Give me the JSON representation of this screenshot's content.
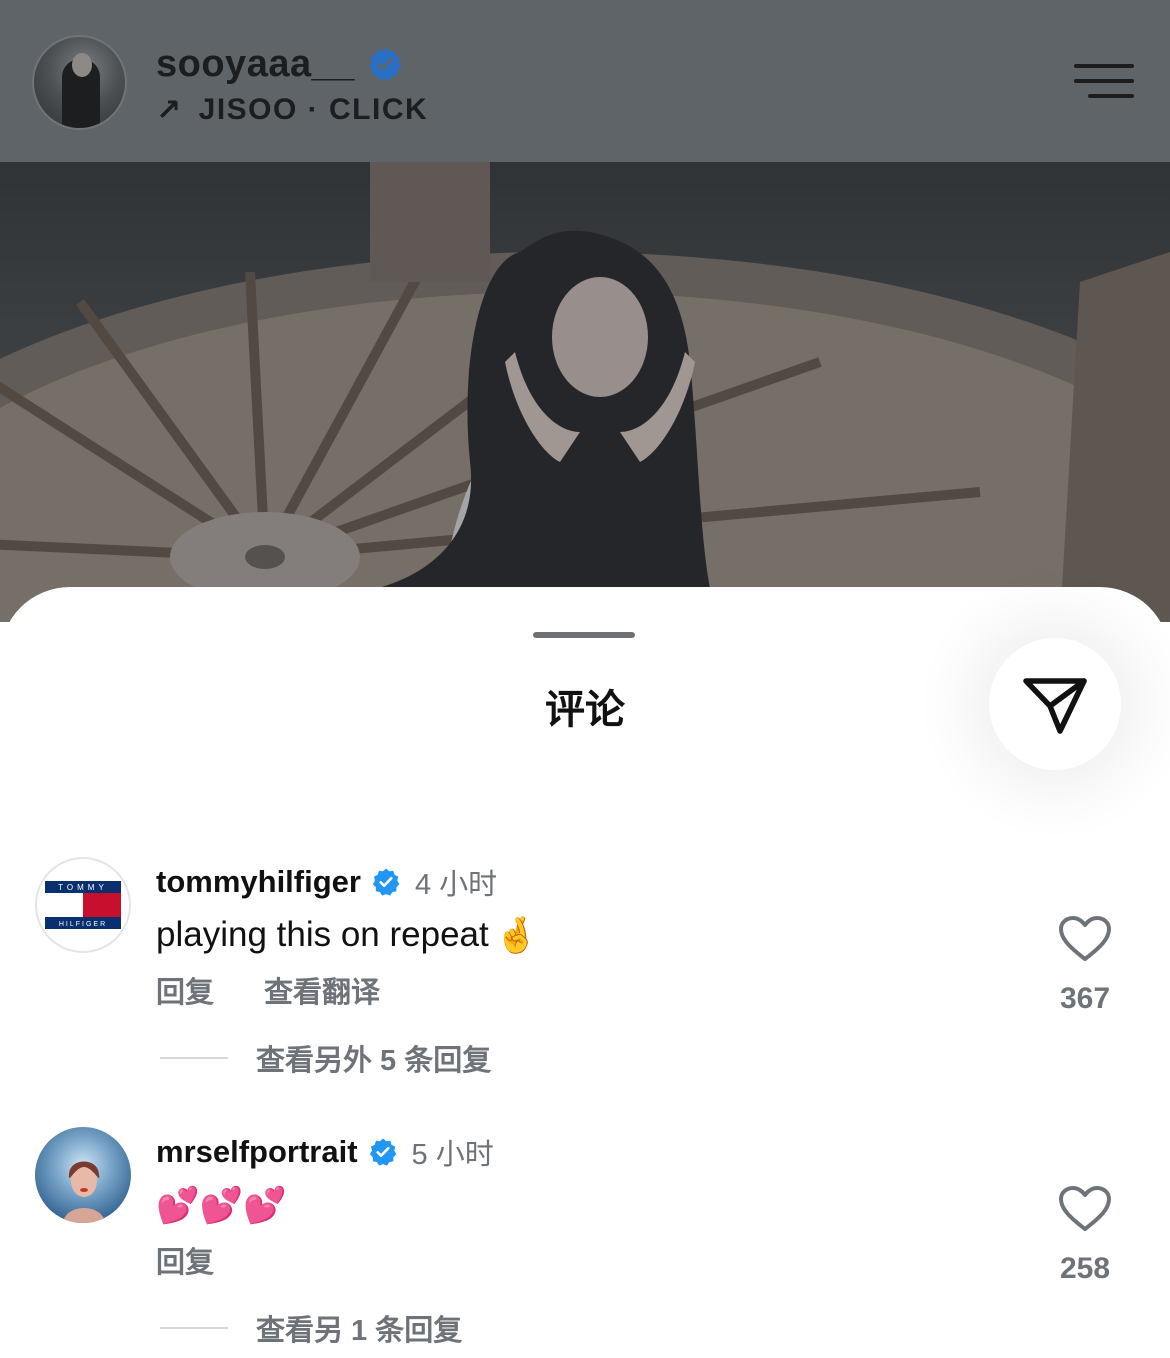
{
  "header": {
    "username": "sooyaaa__",
    "verified": true,
    "subtitle_arrow": "↗",
    "subtitle": "JISOO · CLICK",
    "avatar_icon": "profile-avatar",
    "menu_icon": "hamburger-menu-icon"
  },
  "sheet": {
    "title": "评论",
    "send_icon": "send-paper-plane-icon"
  },
  "comments": [
    {
      "username": "tommyhilfiger",
      "verified": true,
      "time": "4 小时",
      "text": "playing this on repeat",
      "emoji": "🤞",
      "reply_label": "回复",
      "translate_label": "查看翻译",
      "view_replies": "查看另外 5 条回复",
      "likes": "367",
      "avatar_logo_top": "TOMMY",
      "avatar_logo_bottom": "HILFIGER"
    },
    {
      "username": "mrselfportrait",
      "verified": true,
      "time": "5 小时",
      "text": "💕💕💕",
      "reply_label": "回复",
      "view_replies": "查看另 1 条回复",
      "likes": "258"
    }
  ],
  "colors": {
    "header_bg": "#5f6468",
    "verified_blue": "#2196f3",
    "muted_text": "#6d7378"
  }
}
